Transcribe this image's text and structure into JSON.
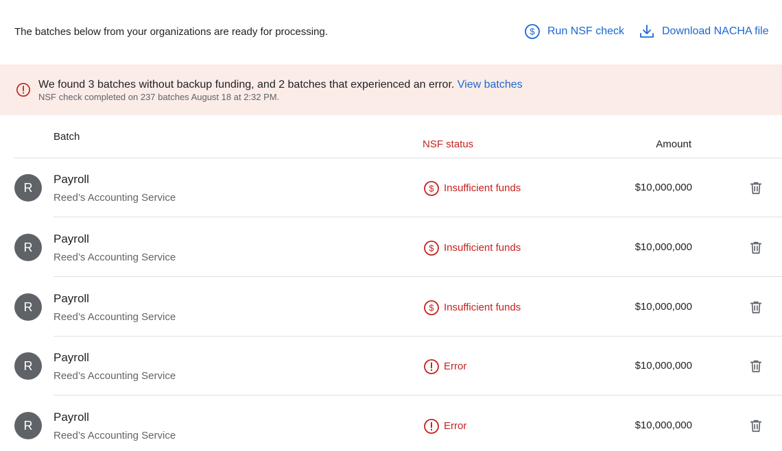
{
  "header": {
    "intro_text": "The batches below from your organizations are ready for processing.",
    "run_nsf_label": "Run NSF check",
    "download_nacha_label": "Download NACHA file"
  },
  "banner": {
    "message": "We found 3 batches without backup funding, and 2 batches that experienced an error.",
    "link_label": "View batches",
    "subtext": "NSF check completed on 237 batches August 18 at 2:32 PM."
  },
  "table": {
    "columns": {
      "batch": "Batch",
      "nsf_status": "NSF status",
      "amount": "Amount"
    },
    "rows": [
      {
        "avatar": "R",
        "name": "Payroll",
        "org": "Reed’s Accounting Service",
        "status": "Insufficient funds",
        "status_icon": "dollar-circle-icon",
        "amount": "$10,000,000"
      },
      {
        "avatar": "R",
        "name": "Payroll",
        "org": "Reed’s Accounting Service",
        "status": "Insufficient funds",
        "status_icon": "dollar-circle-icon",
        "amount": "$10,000,000"
      },
      {
        "avatar": "R",
        "name": "Payroll",
        "org": "Reed’s Accounting Service",
        "status": "Insufficient funds",
        "status_icon": "dollar-circle-icon",
        "amount": "$10,000,000"
      },
      {
        "avatar": "R",
        "name": "Payroll",
        "org": "Reed’s Accounting Service",
        "status": "Error",
        "status_icon": "error-circle-icon",
        "amount": "$10,000,000"
      },
      {
        "avatar": "R",
        "name": "Payroll",
        "org": "Reed’s Accounting Service",
        "status": "Error",
        "status_icon": "error-circle-icon",
        "amount": "$10,000,000"
      }
    ]
  },
  "colors": {
    "accent": "#1a67d2",
    "error": "#c5221f",
    "banner_bg": "#fbece8",
    "avatar_bg": "#5f6368"
  }
}
